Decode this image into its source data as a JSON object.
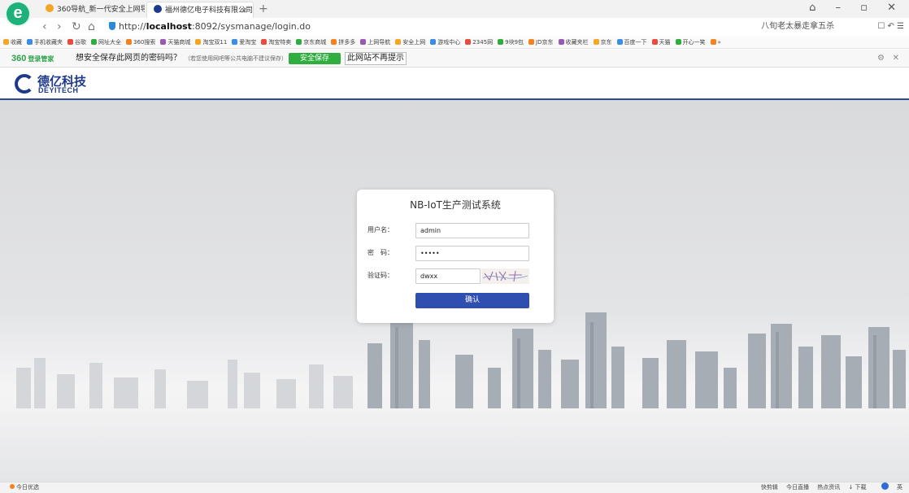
{
  "browser": {
    "logo": "e",
    "tabs": [
      {
        "label": "360导航_新一代安全上网导航",
        "active": false
      },
      {
        "label": "福州德亿电子科技有限公司",
        "active": true
      }
    ],
    "tab_close": "×",
    "new_tab": "+",
    "window_controls": "⌂ – ▫ ✕",
    "nav": {
      "back": "‹",
      "forward": "›",
      "reload": "↻",
      "home": "⌂"
    },
    "url_prefix": "http://",
    "url_host": "localhost",
    "url_rest": ":8092/sysmanage/login.do",
    "search_text": "八旬老太暴走拿五杀",
    "addr_icons": "☐ ↶ ☰"
  },
  "bookmarks": [
    "收藏",
    "手机收藏夹",
    "谷歌",
    "网址大全",
    "360搜索",
    "天猫商城",
    "淘宝双11",
    "爱淘宝",
    "淘宝特卖",
    "京东商城",
    "拼多多",
    "上网导航",
    "安全上网",
    "游戏中心",
    "2345网",
    "9块9包",
    "JD京东",
    "收藏夹栏",
    "京东",
    "百度一下",
    "天猫",
    "开心一笑",
    "»"
  ],
  "password_prompt": {
    "brand": "360",
    "brand_sub": "登录管家",
    "question": "想安全保存此网页的密码吗？",
    "note": "（若您使用网吧等公共电脑不建议保存）",
    "save_label": "安全保存",
    "never_label": "此网站不再提示",
    "settings_icon": "⚙",
    "close_icon": "✕"
  },
  "site": {
    "logo_cn": "德亿科技",
    "logo_en": "DEYITECH"
  },
  "login": {
    "title": "NB-IoT生产测试系统",
    "username_label": "用户名：",
    "username_value": "admin",
    "password_label": "密　码：",
    "password_value": "•••••",
    "captcha_label": "验证码：",
    "captcha_value": "dwxx",
    "submit_label": "确认"
  },
  "statusbar": {
    "left": "今日优选",
    "right": [
      "快剪辑",
      "今日直播",
      "热点资讯",
      "↓ 下载",
      "英"
    ]
  },
  "colors": {
    "header_accent": "#2b4a8f",
    "submit_button": "#2f4fb0",
    "save_button": "#2fae3f"
  }
}
